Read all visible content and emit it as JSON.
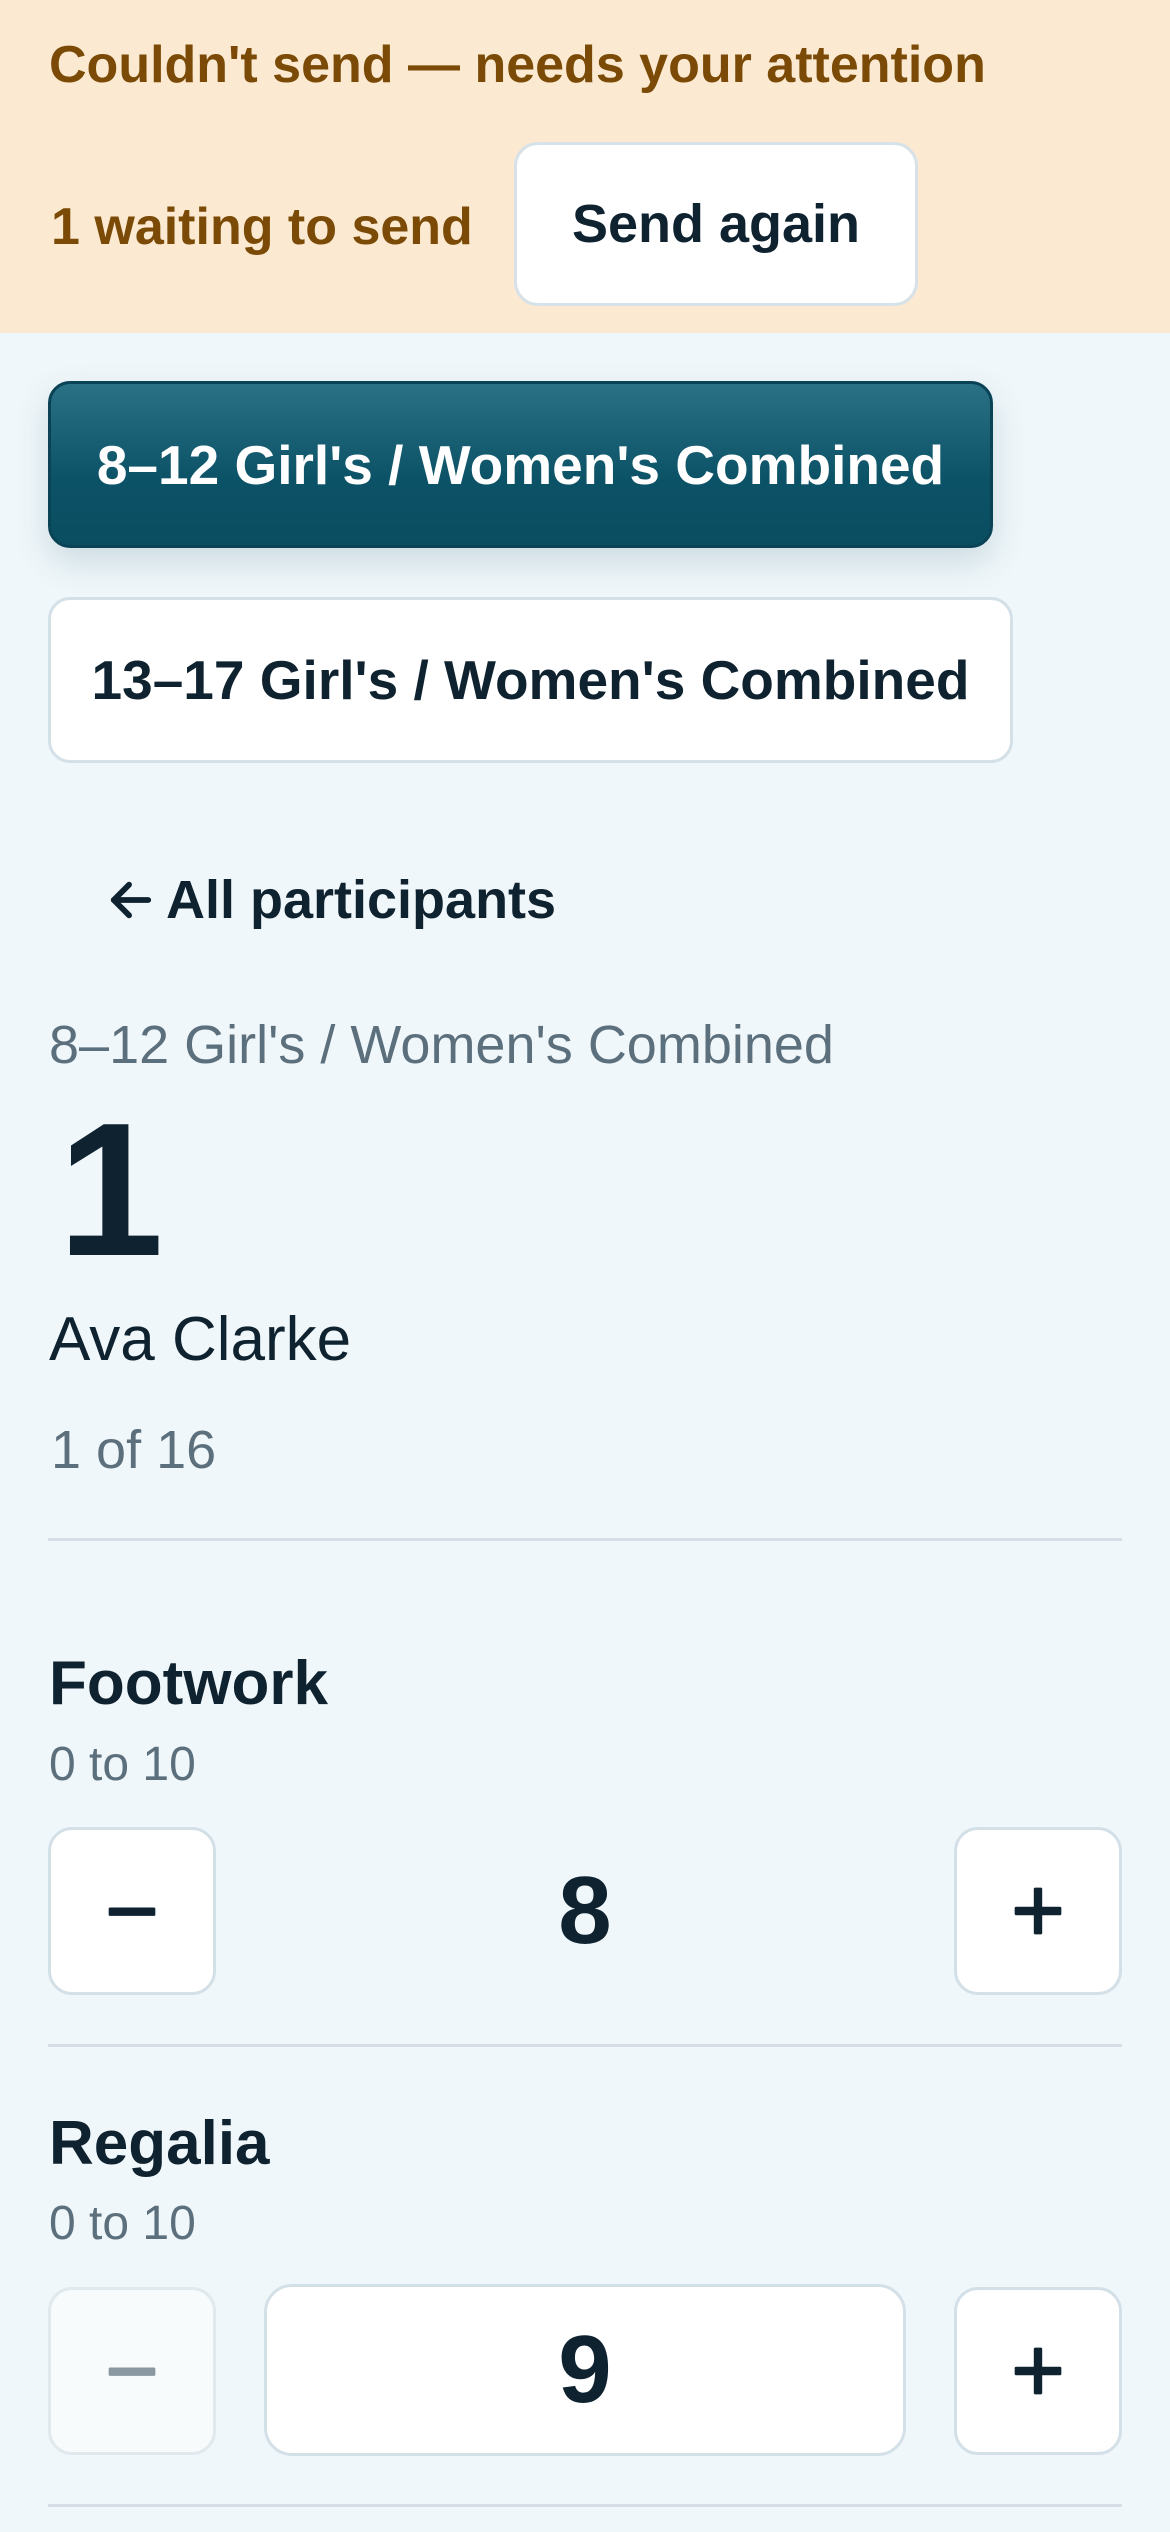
{
  "banner": {
    "title": "Couldn't send — needs your attention",
    "pending": "1 waiting to send",
    "retry_label": "Send again"
  },
  "divisions": [
    {
      "label": "8–12 Girl's / Women's Combined",
      "selected": true
    },
    {
      "label": "13–17 Girl's / Women's Combined",
      "selected": false
    }
  ],
  "back_link": {
    "label": "All participants",
    "icon": "arrow-left-icon"
  },
  "participant": {
    "division": "8–12 Girl's / Women's Combined",
    "number": "1",
    "name": "Ava Clarke",
    "position": "1 of 16"
  },
  "criteria": [
    {
      "title": "Footwork",
      "range": "0 to 10",
      "value": "8",
      "decrement_enabled": true,
      "increment_enabled": true
    },
    {
      "title": "Regalia",
      "range": "0 to 10",
      "value": "9",
      "decrement_enabled": false,
      "increment_enabled": true
    }
  ],
  "colors": {
    "banner_bg": "#fbead1",
    "banner_text": "#7a4a06",
    "accent": "#0c5266",
    "page_bg": "#f0f7fa",
    "text": "#0f2230",
    "muted": "#5c6f7c"
  }
}
